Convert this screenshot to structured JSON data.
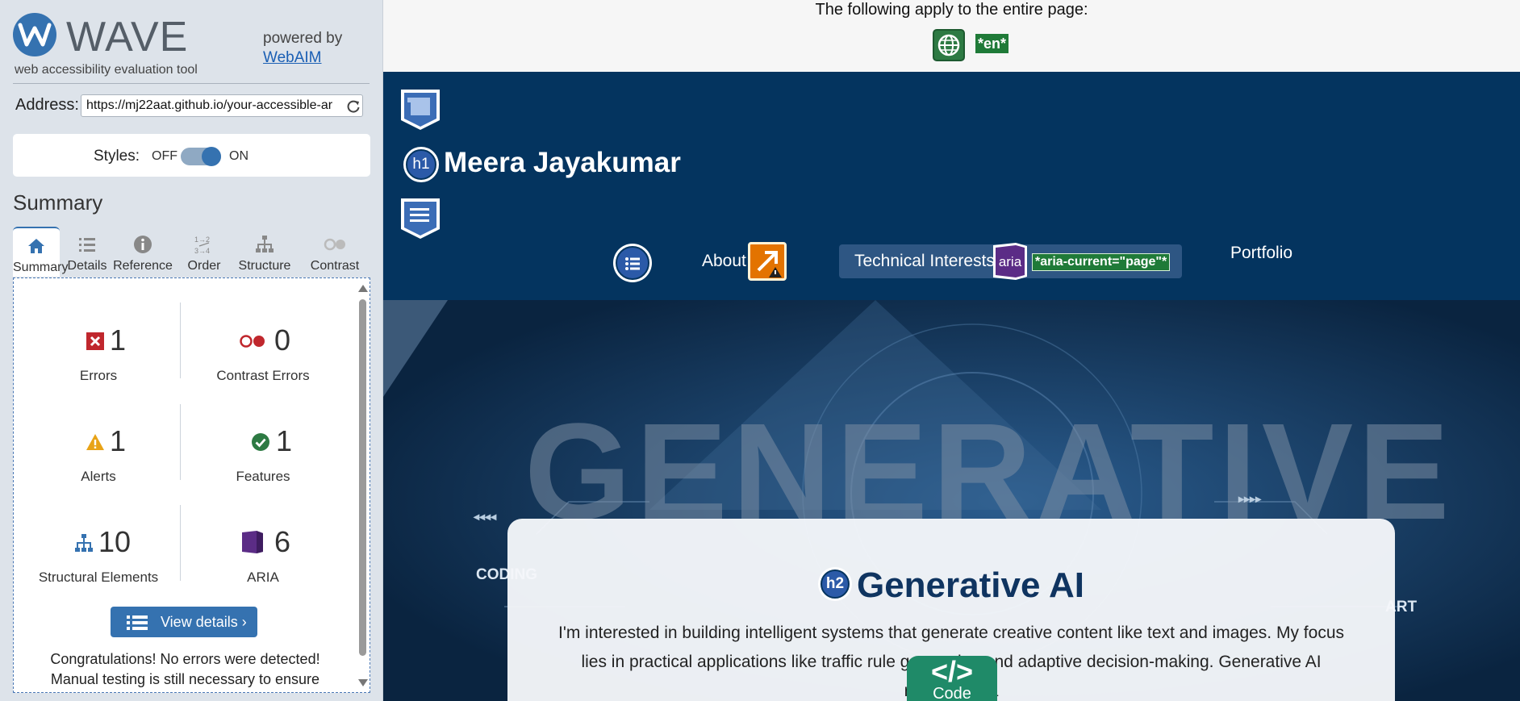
{
  "wave": {
    "logo_text": "WAVE",
    "logo_subtitle": "web accessibility evaluation tool",
    "powered_by": "powered by",
    "powered_link": "WebAIM",
    "address_label": "Address:",
    "address_value": "https://mj22aat.github.io/your-accessible-ar",
    "styles_label": "Styles:",
    "styles_off": "OFF",
    "styles_on": "ON",
    "styles_enabled": true,
    "summary_title": "Summary",
    "tabs": [
      {
        "label": "Summary",
        "icon": "home-icon",
        "active": true
      },
      {
        "label": "Details",
        "icon": "list-icon"
      },
      {
        "label": "Reference",
        "icon": "info-icon"
      },
      {
        "label": "Order",
        "icon": "order-icon"
      },
      {
        "label": "Structure",
        "icon": "structure-icon"
      },
      {
        "label": "Contrast",
        "icon": "contrast-icon"
      }
    ],
    "stats": {
      "errors": {
        "count": "1",
        "label": "Errors",
        "color": "#c0272d"
      },
      "contrast_errors": {
        "count": "0",
        "label": "Contrast Errors",
        "color": "#c0272d"
      },
      "alerts": {
        "count": "1",
        "label": "Alerts",
        "color": "#e8a317"
      },
      "features": {
        "count": "1",
        "label": "Features",
        "color": "#2d7a43"
      },
      "structural": {
        "count": "10",
        "label": "Structural Elements",
        "color": "#3572b0"
      },
      "aria": {
        "count": "6",
        "label": "ARIA",
        "color": "#5b2c86"
      }
    },
    "view_details_label": "View details ›",
    "congrats_line1": "Congratulations! No errors were detected!",
    "congrats_line2": "Manual testing is still necessary to ensure"
  },
  "page": {
    "apply_text": "The following apply to the entire page:",
    "lang_tag": "*en*",
    "site_title": "Meera Jayakumar",
    "h1_badge": "h1",
    "h2_badge": "h2",
    "nav": {
      "about": "About",
      "tech": "Technical Interests",
      "portfolio": "Portfolio",
      "aria_badge": "aria",
      "aria_current": "*aria-current=\"page\"*"
    },
    "hero": {
      "word": "GENERATIVE",
      "label_left": "CODING",
      "label_right": "ART",
      "arrows_left": "◂◂◂◂",
      "arrows_right": "▸▸▸▸"
    },
    "card": {
      "title": "Generative AI",
      "text": "I'm interested in building intelligent systems that generate creative content like text and images. My focus lies in practical applications like traffic rule generation and adaptive decision-making. Generative AI represents a"
    },
    "code_badge": {
      "symbol": "</>",
      "label": "Code"
    }
  },
  "colors": {
    "wave_blue": "#3572b0",
    "header_navy": "#04345f",
    "feature_green": "#1f7a38",
    "alert_orange": "#e37300",
    "aria_purple": "#5b2c86"
  }
}
